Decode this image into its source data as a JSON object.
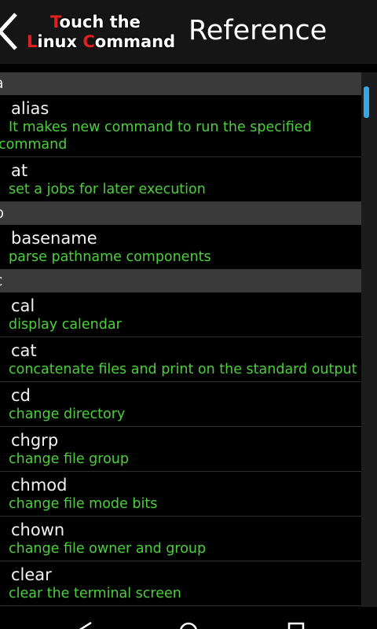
{
  "header": {
    "back_icon": "chevron-left-icon",
    "logo": {
      "line1": {
        "cap": "T",
        "rest": "ouch the"
      },
      "line2": {
        "cap1": "L",
        "rest1": "inux ",
        "cap2": "C",
        "rest2": "ommand"
      }
    },
    "title": "Reference"
  },
  "colors": {
    "description": "#4ccf3c",
    "section_bg": "#3a3a3a",
    "logo_accent": "#e02020",
    "scroll_thumb": "#35a9e8"
  },
  "list": {
    "sections": [
      {
        "letter": "a",
        "items": [
          {
            "command": "alias",
            "description_line1": "It makes new command to run the specified",
            "description_line2": "command"
          },
          {
            "command": "at",
            "description": "set a jobs for later execution"
          }
        ]
      },
      {
        "letter": "b",
        "items": [
          {
            "command": "basename",
            "description": "parse pathname components"
          }
        ]
      },
      {
        "letter": "c",
        "items": [
          {
            "command": "cal",
            "description": "display calendar"
          },
          {
            "command": "cat",
            "description": "concatenate files and print on the standard output"
          },
          {
            "command": "cd",
            "description": "change directory"
          },
          {
            "command": "chgrp",
            "description": "change file group"
          },
          {
            "command": "chmod",
            "description": "change file mode bits"
          },
          {
            "command": "chown",
            "description": "change file owner and group"
          },
          {
            "command": "clear",
            "description": "clear the terminal screen"
          }
        ]
      }
    ]
  },
  "navbar": {
    "back_icon": "nav-back-icon",
    "home_icon": "nav-home-icon",
    "recents_icon": "nav-recents-icon"
  }
}
